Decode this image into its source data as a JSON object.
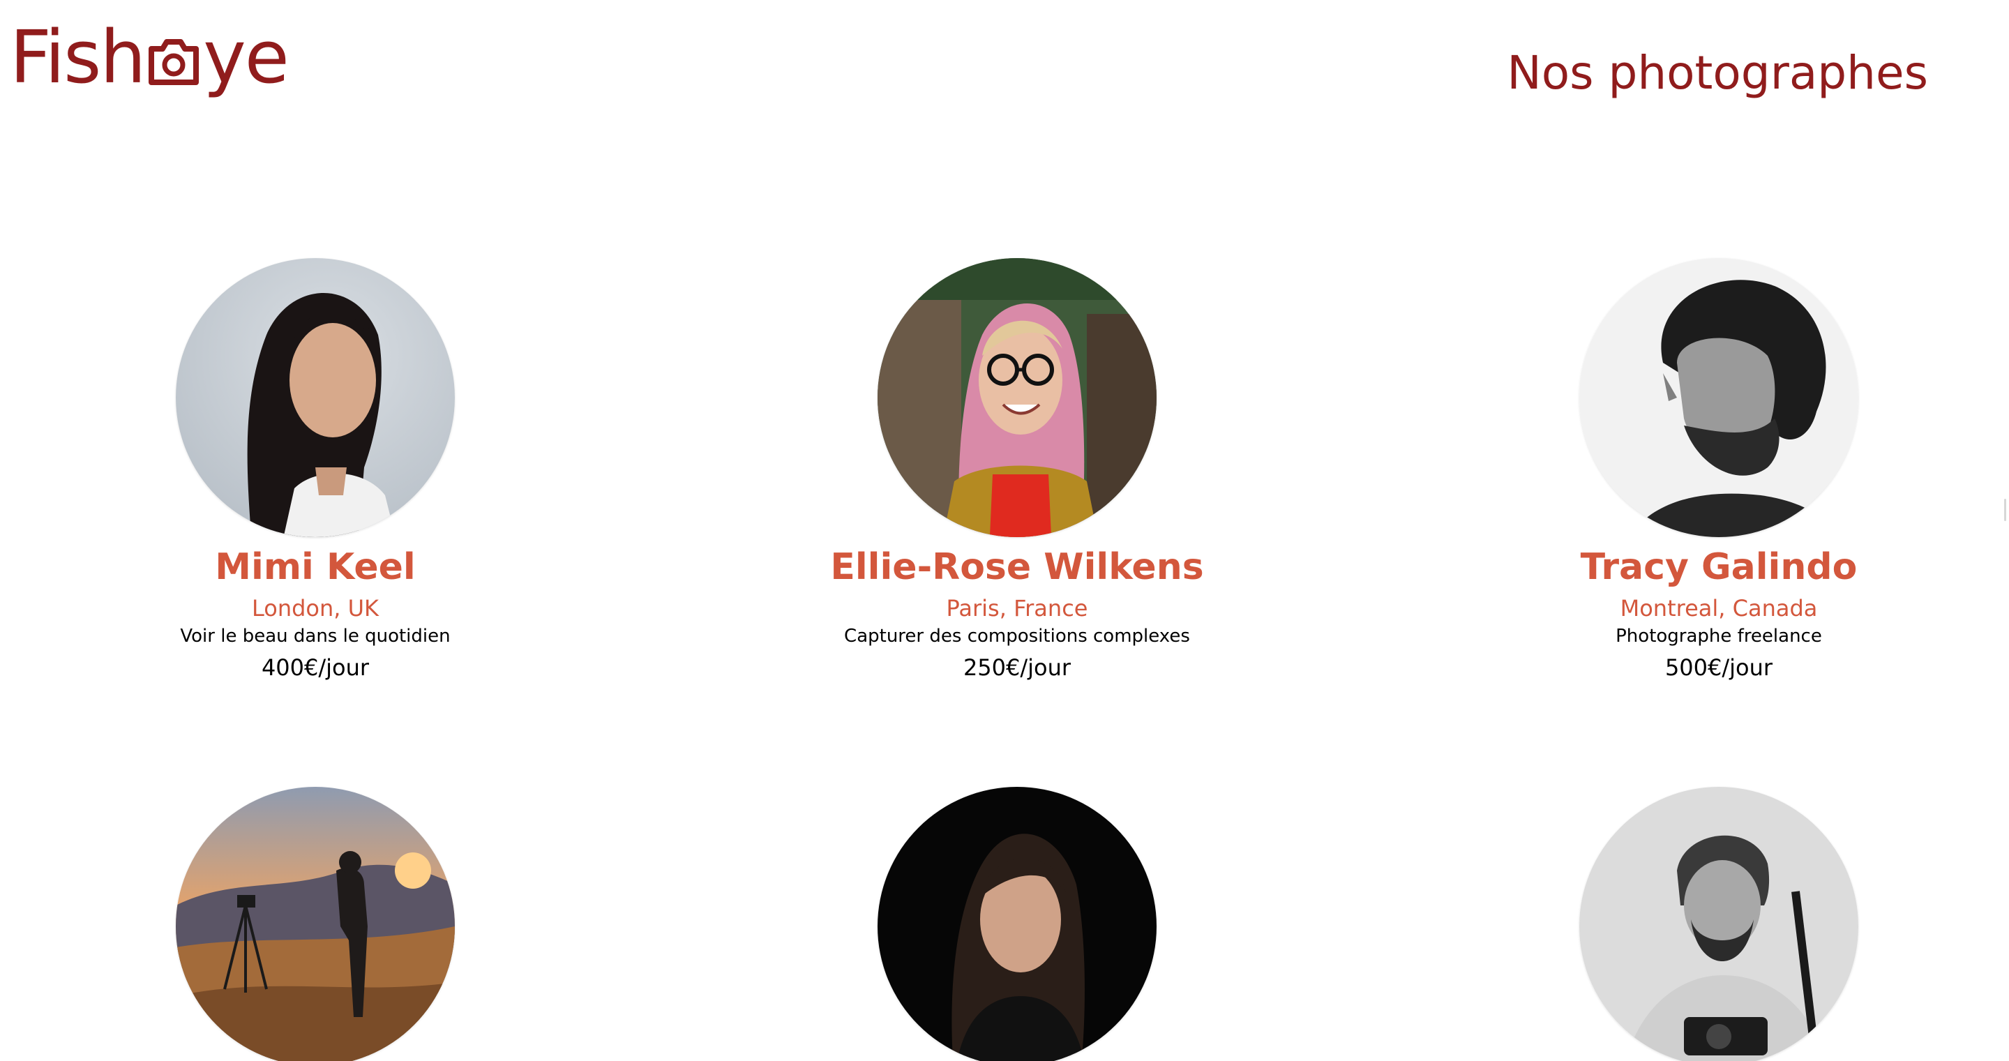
{
  "header": {
    "logo_left": "Fish",
    "logo_right": "ye",
    "heading": "Nos photographes"
  },
  "colors": {
    "primary": "#901C1C",
    "secondary": "#D3573C",
    "text": "#000000",
    "background": "#FFFFFF"
  },
  "photographers": [
    {
      "name": "Mimi Keel",
      "location": "London, UK",
      "tagline": "Voir le beau dans le quotidien",
      "price": "400€/jour"
    },
    {
      "name": "Ellie-Rose Wilkens",
      "location": "Paris, France",
      "tagline": "Capturer des compositions complexes",
      "price": "250€/jour"
    },
    {
      "name": "Tracy Galindo",
      "location": "Montreal, Canada",
      "tagline": "Photographe freelance",
      "price": "500€/jour"
    },
    {
      "name": "",
      "location": "",
      "tagline": "",
      "price": ""
    },
    {
      "name": "",
      "location": "",
      "tagline": "",
      "price": ""
    },
    {
      "name": "",
      "location": "",
      "tagline": "",
      "price": ""
    }
  ]
}
